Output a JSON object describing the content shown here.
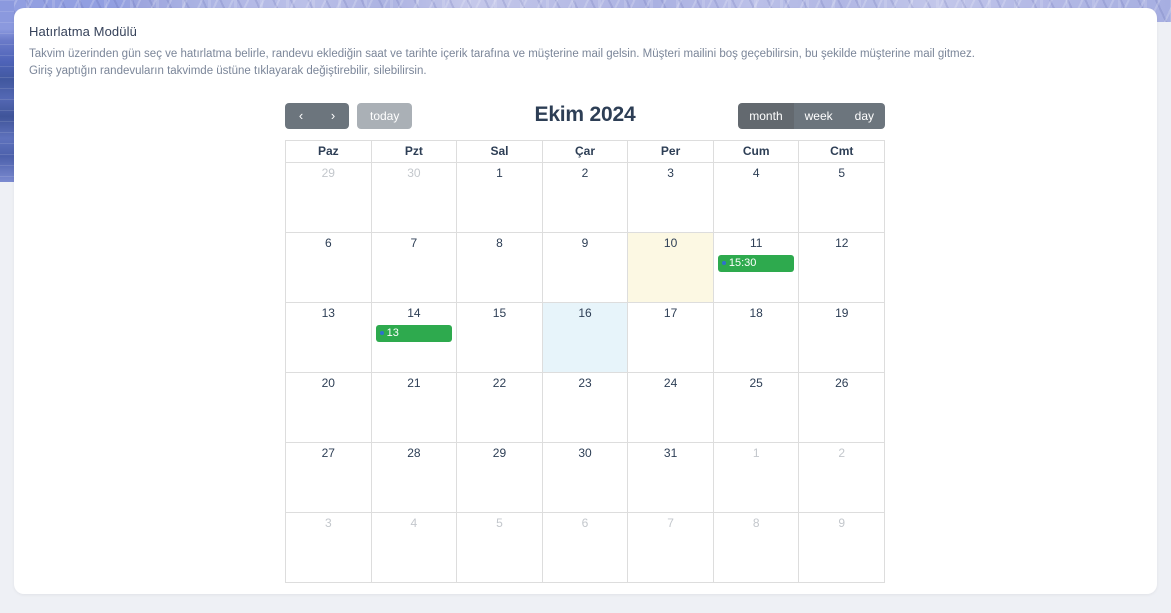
{
  "module": {
    "title": "Hatırlatma Modülü",
    "description_lines": [
      "Takvim üzerinden gün seç ve hatırlatma belirle, randevu eklediğin saat ve tarihte içerik tarafına ve müşterine mail gelsin. Müşteri mailini boş geçebilirsin, bu şekilde müşterine mail gitmez.",
      "Giriş yaptığın randevuların takvimde üstüne tıklayarak değiştirebilir, silebilirsin."
    ]
  },
  "calendar": {
    "title": "Ekim 2024",
    "nav": {
      "prev_label": "‹",
      "next_label": "›",
      "today_label": "today"
    },
    "views": [
      {
        "label": "month",
        "active": true
      },
      {
        "label": "week",
        "active": false
      },
      {
        "label": "day",
        "active": false
      }
    ],
    "weekday_headers": [
      "Paz",
      "Pzt",
      "Sal",
      "Çar",
      "Per",
      "Cum",
      "Cmt"
    ],
    "weeks": [
      [
        {
          "day": "29",
          "other_month": true
        },
        {
          "day": "30",
          "other_month": true
        },
        {
          "day": "1"
        },
        {
          "day": "2"
        },
        {
          "day": "3"
        },
        {
          "day": "4"
        },
        {
          "day": "5"
        }
      ],
      [
        {
          "day": "6"
        },
        {
          "day": "7"
        },
        {
          "day": "8"
        },
        {
          "day": "9"
        },
        {
          "day": "10",
          "today": true
        },
        {
          "day": "11",
          "event": "15:30"
        },
        {
          "day": "12"
        }
      ],
      [
        {
          "day": "13"
        },
        {
          "day": "14",
          "event": "13"
        },
        {
          "day": "15"
        },
        {
          "day": "16",
          "selected": true
        },
        {
          "day": "17"
        },
        {
          "day": "18"
        },
        {
          "day": "19"
        }
      ],
      [
        {
          "day": "20"
        },
        {
          "day": "21"
        },
        {
          "day": "22"
        },
        {
          "day": "23"
        },
        {
          "day": "24"
        },
        {
          "day": "25"
        },
        {
          "day": "26"
        }
      ],
      [
        {
          "day": "27"
        },
        {
          "day": "28"
        },
        {
          "day": "29"
        },
        {
          "day": "30"
        },
        {
          "day": "31"
        },
        {
          "day": "1",
          "other_month": true
        },
        {
          "day": "2",
          "other_month": true
        }
      ],
      [
        {
          "day": "3",
          "other_month": true
        },
        {
          "day": "4",
          "other_month": true
        },
        {
          "day": "5",
          "other_month": true
        },
        {
          "day": "6",
          "other_month": true
        },
        {
          "day": "7",
          "other_month": true
        },
        {
          "day": "8",
          "other_month": true
        },
        {
          "day": "9",
          "other_month": true
        }
      ]
    ]
  },
  "colors": {
    "event_green": "#2eaa4e",
    "today_yellow": "#fcf8e3",
    "selected_blue": "#e7f4fa",
    "button_gray": "#6c757d",
    "title_navy": "#2d3e55"
  }
}
